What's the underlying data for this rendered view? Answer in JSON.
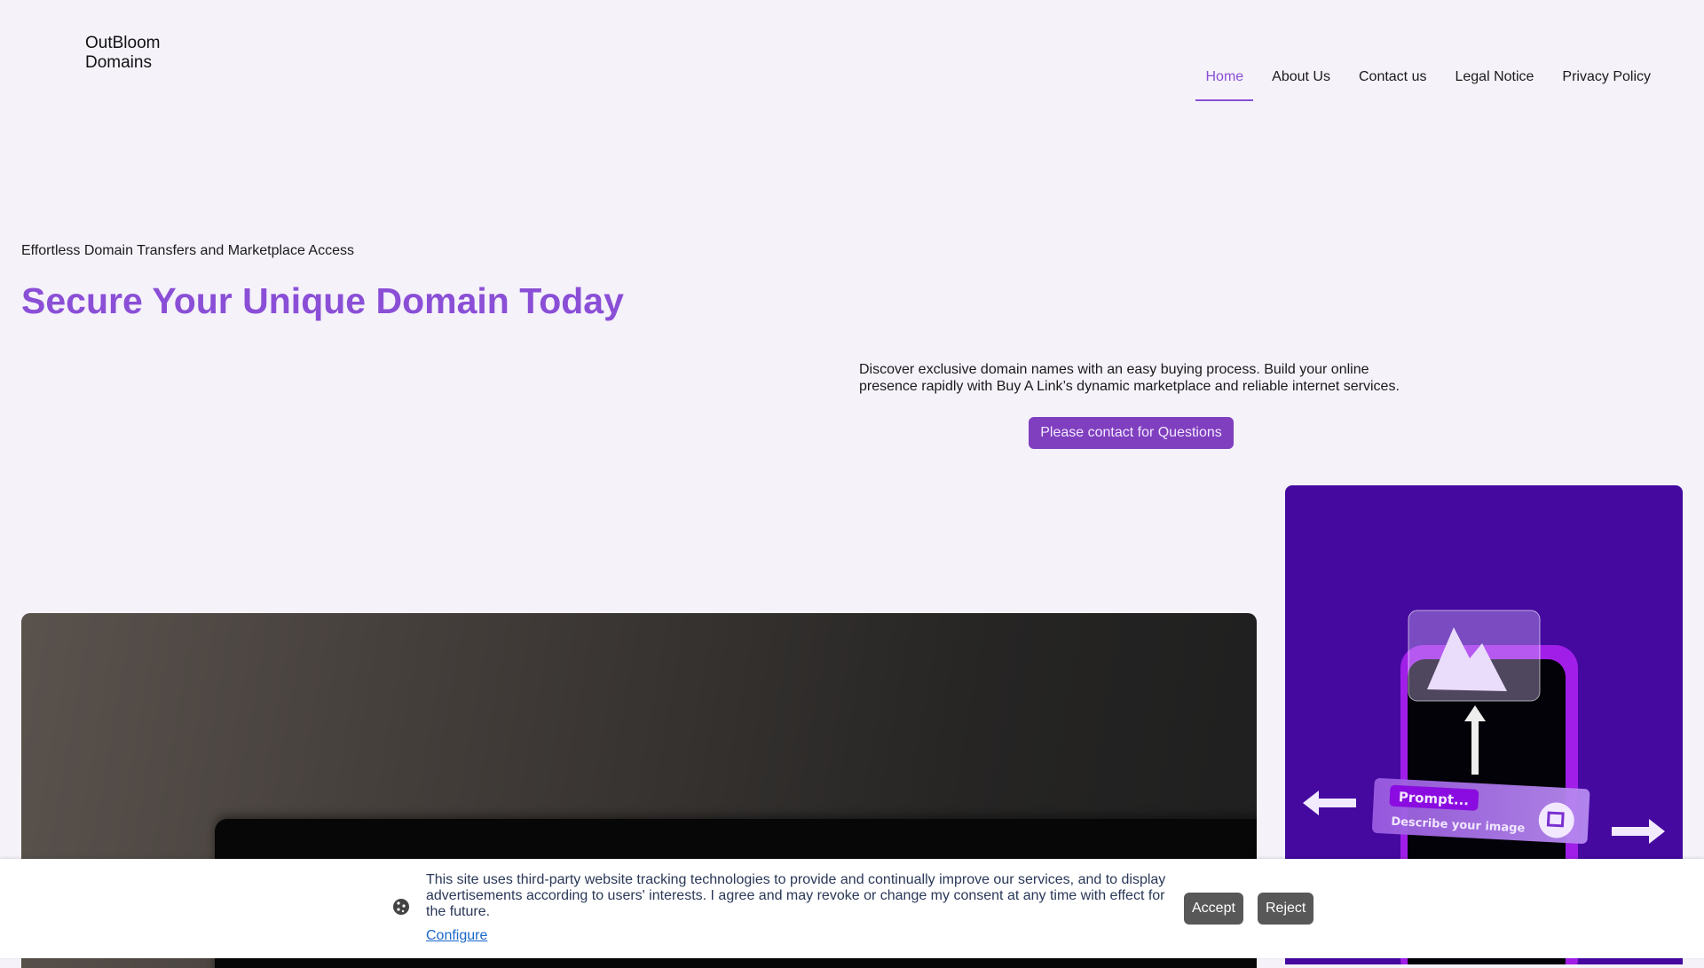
{
  "header": {
    "logo_line1": "OutBloom",
    "logo_line2": "Domains",
    "nav": [
      {
        "label": "Home",
        "active": true
      },
      {
        "label": "About Us"
      },
      {
        "label": "Contact us"
      },
      {
        "label": "Legal Notice"
      },
      {
        "label": "Privacy Policy"
      }
    ]
  },
  "hero": {
    "eyebrow": "Effortless Domain Transfers and Marketplace Access",
    "title": "Secure Your Unique Domain Today",
    "description": "Discover exclusive domain names with an easy buying process. Build your online presence rapidly with Buy A Link’s dynamic marketplace and reliable internet services.",
    "cta_label": "Please contact for Questions",
    "illustration": {
      "prompt_label": "Prompt...",
      "prompt_hint": "Describe your image"
    }
  },
  "cookie_banner": {
    "text": "This site uses third-party website tracking technologies to provide and continually improve our services, and to display advertisements according to users' interests. I agree and may revoke or change my consent at any time with effect for the future.",
    "configure_label": "Configure",
    "accept_label": "Accept",
    "reject_label": "Reject",
    "icon": "cookie-icon"
  },
  "colors": {
    "accent": "#8a4fd6",
    "button": "#7f3fbf",
    "illustration_bg": "#4509a0"
  }
}
